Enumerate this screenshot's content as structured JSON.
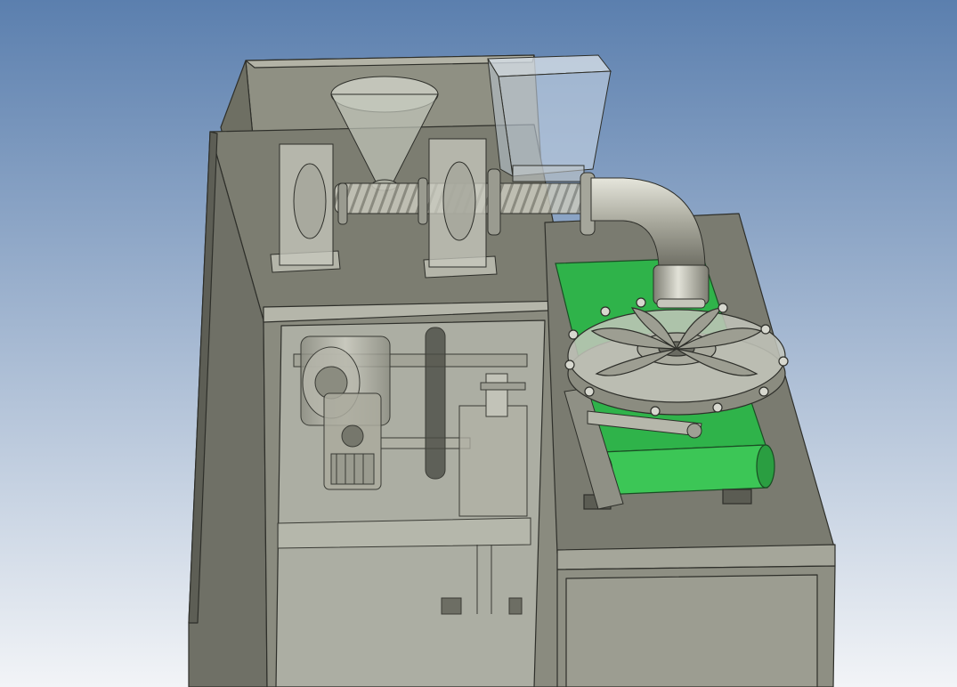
{
  "viewport": {
    "background_top": "#5b7fae",
    "background_bottom": "#f2f4f7"
  },
  "colors": {
    "housing_dark": "#6e6f63",
    "housing_mid": "#8f9083",
    "housing_light": "#b3b3a6",
    "glass": "#c9ccc1",
    "metal": "#bdbdb1",
    "edge": "#2e2f2a",
    "conveyor_green": "#2fb34a",
    "conveyor_green_light": "#4fd36a",
    "hopper_glass": "#c7d4e2"
  }
}
